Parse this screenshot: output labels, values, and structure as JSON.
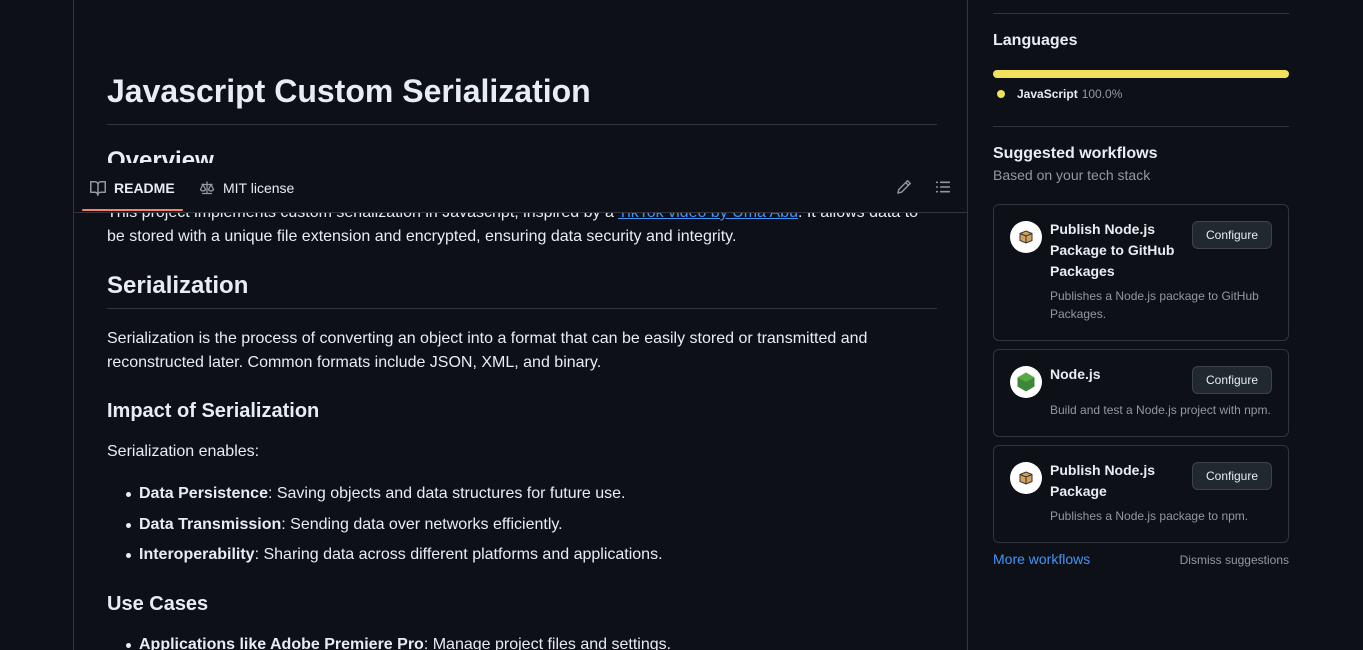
{
  "readme": {
    "title": "Javascript Custom Serialization",
    "overview_heading": "Overview",
    "overview_text_before": "This project implements custom serialization in Javascript, inspired by a ",
    "overview_link": "TikTok video by Uma Abu",
    "overview_text_after": ". It allows data to be stored with a unique file extension and encrypted, ensuring data security and integrity.",
    "serialization_heading": "Serialization",
    "serialization_text": "Serialization is the process of converting an object into a format that can be easily stored or transmitted and reconstructed later. Common formats include JSON, XML, and binary.",
    "impact_heading": "Impact of Serialization",
    "impact_intro": "Serialization enables:",
    "impact_items": [
      {
        "term": "Data Persistence",
        "desc": ": Saving objects and data structures for future use."
      },
      {
        "term": "Data Transmission",
        "desc": ": Sending data over networks efficiently."
      },
      {
        "term": "Interoperability",
        "desc": ": Sharing data across different platforms and applications."
      }
    ],
    "use_cases_heading": "Use Cases",
    "use_case_items": [
      {
        "term": "Applications like Adobe Premiere Pro",
        "desc": ": Manage project files and settings."
      }
    ]
  },
  "tabs": [
    {
      "label": "README",
      "icon": "book-icon",
      "active": true
    },
    {
      "label": "MIT license",
      "icon": "law-icon",
      "active": false
    }
  ],
  "toolbar": {
    "edit_icon": "pencil-icon",
    "outline_icon": "list-icon"
  },
  "sidebar": {
    "languages_heading": "Languages",
    "language": {
      "name": "JavaScript",
      "percent": "100.0%",
      "share": 1.0,
      "color": "#f1e05a"
    },
    "workflows_heading": "Suggested workflows",
    "workflows_subtitle": "Based on your tech stack",
    "workflows": [
      {
        "title": "Publish Node.js Package to GitHub Packages",
        "desc": "Publishes a Node.js package to GitHub Packages.",
        "button": "Configure",
        "icon": "package-icon"
      },
      {
        "title": "Node.js",
        "desc": "Build and test a Node.js project with npm.",
        "button": "Configure",
        "icon": "nodejs-icon"
      },
      {
        "title": "Publish Node.js Package",
        "desc": "Publishes a Node.js package to npm.",
        "button": "Configure",
        "icon": "package-icon"
      }
    ],
    "more_workflows": "More workflows",
    "dismiss": "Dismiss suggestions"
  },
  "colors": {
    "background": "#0d1117",
    "border": "#30363d",
    "link": "#4493f8",
    "tab_accent": "#f78166",
    "muted": "#9198a1"
  }
}
